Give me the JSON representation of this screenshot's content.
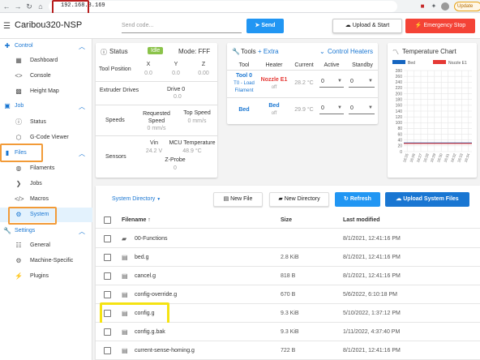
{
  "browser": {
    "url": "192.168.3.169",
    "update_label": "Update"
  },
  "appbar": {
    "title": "Caribou320-NSP",
    "send_placeholder": "Send code...",
    "send_label": "Send",
    "upload_start_label": "Upload & Start",
    "estop_label": "Emergency Stop"
  },
  "sidebar": {
    "sections": [
      {
        "label": "Control",
        "icon": "gamepad-icon",
        "items": [
          {
            "label": "Dashboard",
            "icon": "dashboard-icon"
          },
          {
            "label": "Console",
            "icon": "code-icon"
          },
          {
            "label": "Height Map",
            "icon": "grid-icon"
          }
        ]
      },
      {
        "label": "Job",
        "icon": "printer-icon",
        "items": [
          {
            "label": "Status",
            "icon": "info-icon"
          },
          {
            "label": "G-Code Viewer",
            "icon": "cube-icon"
          }
        ]
      },
      {
        "label": "Files",
        "icon": "sd-card-icon",
        "items": [
          {
            "label": "Filaments",
            "icon": "filament-icon"
          },
          {
            "label": "Jobs",
            "icon": "list-icon"
          },
          {
            "label": "Macros",
            "icon": "code-icon"
          },
          {
            "label": "System",
            "icon": "gear-icon"
          }
        ]
      },
      {
        "label": "Settings",
        "icon": "wrench-icon",
        "items": [
          {
            "label": "General",
            "icon": "sliders-icon"
          },
          {
            "label": "Machine-Specific",
            "icon": "gears-icon"
          },
          {
            "label": "Plugins",
            "icon": "plug-icon"
          }
        ]
      }
    ]
  },
  "status": {
    "title": "Status",
    "state": "Idle",
    "mode_label": "Mode: FFF",
    "tool_position_label": "Tool Position",
    "axes": [
      "X",
      "Y",
      "Z"
    ],
    "positions": [
      "0.0",
      "0.0",
      "0.00"
    ],
    "extruder_drives_label": "Extruder Drives",
    "drive_label": "Drive 0",
    "drive_value": "0.0",
    "speeds_label": "Speeds",
    "requested_speed_label": "Requested Speed",
    "requested_speed_value": "0 mm/s",
    "top_speed_label": "Top Speed",
    "top_speed_value": "0 mm/s",
    "sensors_label": "Sensors",
    "vin_label": "Vin",
    "vin_value": "24.2 V",
    "mcu_label": "MCU Temperature",
    "mcu_value": "48.9 °C",
    "zprobe_label": "Z-Probe",
    "zprobe_value": "0"
  },
  "tools": {
    "title": "Tools",
    "extra_label": "+ Extra",
    "control_heaters_label": "Control Heaters",
    "headers": [
      "Tool",
      "Heater",
      "Current",
      "Active",
      "Standby"
    ],
    "rows": [
      {
        "tool": "Tool 0",
        "tool_sub": "T0 - Load Filament",
        "heater": "Nozzle E1",
        "heater_state": "off",
        "current": "28.2 °C",
        "active": "0",
        "standby": "0"
      },
      {
        "tool": "Bed",
        "tool_sub": "",
        "heater": "Bed",
        "heater_state": "off",
        "current": "29.9 °C",
        "active": "0",
        "standby": "0"
      }
    ]
  },
  "chart_data": {
    "type": "line",
    "title": "Temperature Chart",
    "series": [
      {
        "name": "Bed",
        "color": "#1565c0",
        "values": [
          29.9,
          29.9,
          29.9,
          29.9,
          29.9,
          29.9,
          29.9,
          29.9,
          29.9,
          29.9,
          29.9,
          29.9
        ]
      },
      {
        "name": "Nozzle E1",
        "color": "#e53935",
        "values": [
          28.2,
          28.2,
          28.2,
          28.2,
          28.2,
          28.2,
          28.2,
          28.2,
          28.2,
          28.2,
          28.2,
          28.2
        ]
      }
    ],
    "x": [
      "16:25",
      "16:26",
      "16:27",
      "16:28",
      "16:29",
      "16:30",
      "16:31",
      "16:32",
      "16:33",
      "16:34"
    ],
    "yticks": [
      0,
      20,
      40,
      60,
      80,
      100,
      120,
      140,
      160,
      180,
      200,
      220,
      240,
      260,
      280
    ],
    "ylim": [
      0,
      280
    ],
    "grid": true,
    "legend": "top"
  },
  "files": {
    "directory_label": "System Directory",
    "new_file_label": "New File",
    "new_directory_label": "New Directory",
    "refresh_label": "Refresh",
    "upload_label": "Upload System Files",
    "columns": [
      "Filename ↑",
      "Size",
      "Last modified"
    ],
    "rows": [
      {
        "type": "folder",
        "name": "00-Functions",
        "size": "",
        "date": "8/1/2021, 12:41:16 PM"
      },
      {
        "type": "file",
        "name": "bed.g",
        "size": "2.8 KiB",
        "date": "8/1/2021, 12:41:16 PM"
      },
      {
        "type": "file",
        "name": "cancel.g",
        "size": "818 B",
        "date": "8/1/2021, 12:41:16 PM"
      },
      {
        "type": "file",
        "name": "config-override.g",
        "size": "670 B",
        "date": "5/6/2022, 6:10:18 PM"
      },
      {
        "type": "file",
        "name": "config.g",
        "size": "9.3 KiB",
        "date": "5/10/2022, 1:37:12 PM"
      },
      {
        "type": "file",
        "name": "config.g.bak",
        "size": "9.3 KiB",
        "date": "1/11/2022, 4:37:40 PM"
      },
      {
        "type": "file",
        "name": "current-sense-homing.g",
        "size": "722 B",
        "date": "8/1/2021, 12:41:16 PM"
      }
    ]
  }
}
